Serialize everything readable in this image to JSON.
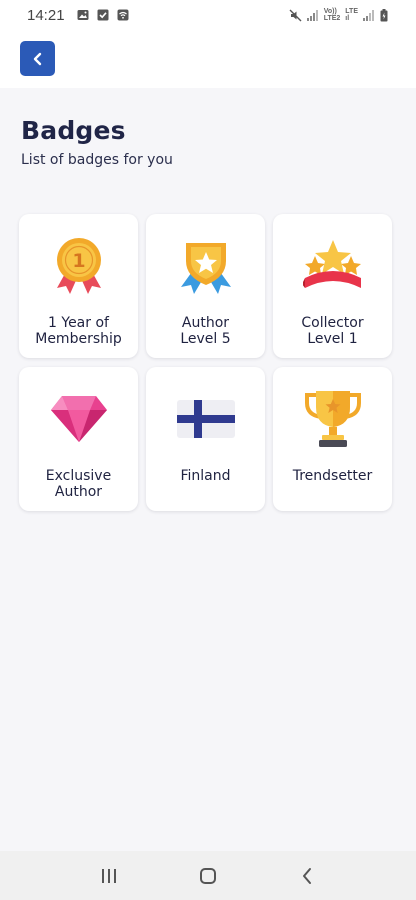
{
  "status_bar": {
    "time": "14:21",
    "network_1_top": "Vo))",
    "network_1_bottom": "LTE2",
    "network_2_top": "LTE",
    "network_2_bottom": "ıl"
  },
  "header": {
    "back_icon": "chevron-left-icon"
  },
  "page": {
    "title": "Badges",
    "subtitle": "List of badges for you"
  },
  "badges": [
    {
      "label": "1 Year of\nMembership",
      "icon": "medal-icon"
    },
    {
      "label": "Author\nLevel 5",
      "icon": "star-shield-medal-icon"
    },
    {
      "label": "Collector\nLevel 1",
      "icon": "star-ribbon-icon"
    },
    {
      "label": "Exclusive\nAuthor",
      "icon": "diamond-icon"
    },
    {
      "label": "Finland",
      "icon": "finland-flag-icon"
    },
    {
      "label": "Trendsetter",
      "icon": "trophy-icon"
    }
  ],
  "colors": {
    "accent": "#2b5ab7",
    "background": "#f6f6f9",
    "card": "#ffffff",
    "title": "#202547"
  }
}
